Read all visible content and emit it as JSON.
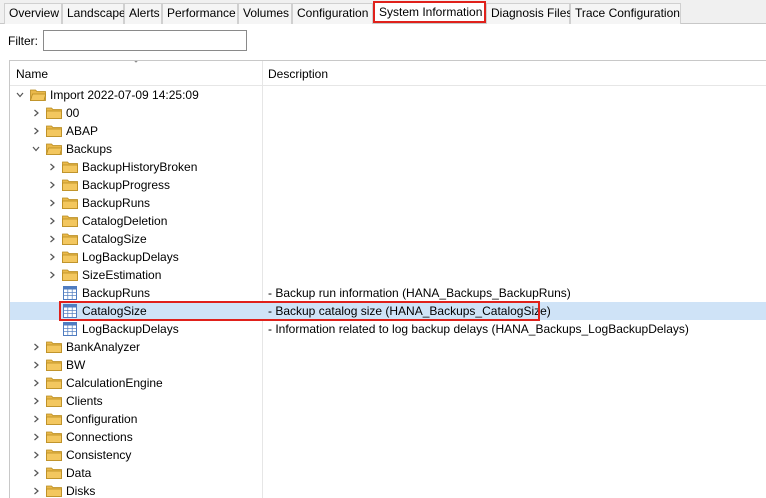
{
  "tabs": [
    {
      "label": "Overview"
    },
    {
      "label": "Landscape"
    },
    {
      "label": "Alerts"
    },
    {
      "label": "Performance"
    },
    {
      "label": "Volumes"
    },
    {
      "label": "Configuration"
    },
    {
      "label": "System Information",
      "active": true
    },
    {
      "label": "Diagnosis Files"
    },
    {
      "label": "Trace Configuration"
    }
  ],
  "filter": {
    "label": "Filter:",
    "value": ""
  },
  "columns": {
    "name": "Name",
    "description": "Description"
  },
  "tree": [
    {
      "name": "Import 2022-07-09 14:25:09",
      "level": 0,
      "type": "folder",
      "state": "expanded",
      "description": ""
    },
    {
      "name": "00",
      "level": 1,
      "type": "folder",
      "state": "collapsed",
      "description": ""
    },
    {
      "name": "ABAP",
      "level": 1,
      "type": "folder",
      "state": "collapsed",
      "description": ""
    },
    {
      "name": "Backups",
      "level": 1,
      "type": "folder",
      "state": "expanded",
      "description": ""
    },
    {
      "name": "BackupHistoryBroken",
      "level": 2,
      "type": "folder",
      "state": "collapsed",
      "description": ""
    },
    {
      "name": "BackupProgress",
      "level": 2,
      "type": "folder",
      "state": "collapsed",
      "description": ""
    },
    {
      "name": "BackupRuns",
      "level": 2,
      "type": "folder",
      "state": "collapsed",
      "description": ""
    },
    {
      "name": "CatalogDeletion",
      "level": 2,
      "type": "folder",
      "state": "collapsed",
      "description": ""
    },
    {
      "name": "CatalogSize",
      "level": 2,
      "type": "folder",
      "state": "collapsed",
      "description": ""
    },
    {
      "name": "LogBackupDelays",
      "level": 2,
      "type": "folder",
      "state": "collapsed",
      "description": ""
    },
    {
      "name": "SizeEstimation",
      "level": 2,
      "type": "folder",
      "state": "collapsed",
      "description": ""
    },
    {
      "name": "BackupRuns",
      "level": 2,
      "type": "table",
      "state": "leaf",
      "description": "- Backup run information (HANA_Backups_BackupRuns)"
    },
    {
      "name": "CatalogSize",
      "level": 2,
      "type": "table",
      "state": "leaf",
      "selected": true,
      "description": "- Backup catalog size (HANA_Backups_CatalogSize)"
    },
    {
      "name": "LogBackupDelays",
      "level": 2,
      "type": "table",
      "state": "leaf",
      "description": "- Information related to log backup delays (HANA_Backups_LogBackupDelays)"
    },
    {
      "name": "BankAnalyzer",
      "level": 1,
      "type": "folder",
      "state": "collapsed",
      "description": ""
    },
    {
      "name": "BW",
      "level": 1,
      "type": "folder",
      "state": "collapsed",
      "description": ""
    },
    {
      "name": "CalculationEngine",
      "level": 1,
      "type": "folder",
      "state": "collapsed",
      "description": ""
    },
    {
      "name": "Clients",
      "level": 1,
      "type": "folder",
      "state": "collapsed",
      "description": ""
    },
    {
      "name": "Configuration",
      "level": 1,
      "type": "folder",
      "state": "collapsed",
      "description": ""
    },
    {
      "name": "Connections",
      "level": 1,
      "type": "folder",
      "state": "collapsed",
      "description": ""
    },
    {
      "name": "Consistency",
      "level": 1,
      "type": "folder",
      "state": "collapsed",
      "description": ""
    },
    {
      "name": "Data",
      "level": 1,
      "type": "folder",
      "state": "collapsed",
      "description": ""
    },
    {
      "name": "Disks",
      "level": 1,
      "type": "folder",
      "state": "collapsed",
      "description": ""
    }
  ],
  "colors": {
    "highlight": "#e0211b",
    "selection": "#cfe3f7",
    "folder": "#f3c75f",
    "table": "#4f7cc0"
  }
}
